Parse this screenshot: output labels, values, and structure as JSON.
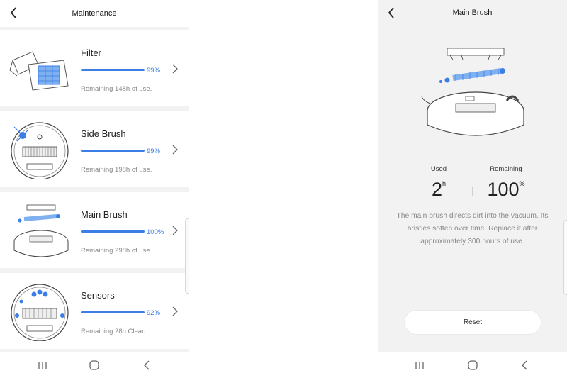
{
  "left": {
    "title": "Maintenance",
    "items": [
      {
        "name": "Filter",
        "percent": 99,
        "percent_label": "99%",
        "remaining": "Remaining 148h of use.",
        "icon": "filter-illustration"
      },
      {
        "name": "Side Brush",
        "percent": 99,
        "percent_label": "99%",
        "remaining": "Remaining 198h of use.",
        "icon": "side-brush-illustration"
      },
      {
        "name": "Main Brush",
        "percent": 100,
        "percent_label": "100%",
        "remaining": "Remaining 298h of use.",
        "icon": "main-brush-illustration"
      },
      {
        "name": "Sensors",
        "percent": 92,
        "percent_label": "92%",
        "remaining": "Remaining 28h Clean",
        "icon": "sensors-illustration"
      }
    ]
  },
  "right": {
    "title": "Main Brush",
    "used_label": "Used",
    "used_value": "2",
    "used_unit": "h",
    "remaining_label": "Remaining",
    "remaining_value": "100",
    "remaining_unit": "%",
    "description": "The main brush directs dirt into the vacuum. Its bristles soften over time. Replace it after approximately 300 hours of use.",
    "reset_label": "Reset"
  },
  "icons": {
    "back": "back-chevron-icon",
    "chevron": "chevron-right-icon",
    "nav": [
      "recent-apps-icon",
      "home-icon",
      "nav-back-icon"
    ]
  },
  "colors": {
    "accent": "#3a7ee6",
    "background": "#f2f2f2",
    "card": "#ffffff"
  }
}
